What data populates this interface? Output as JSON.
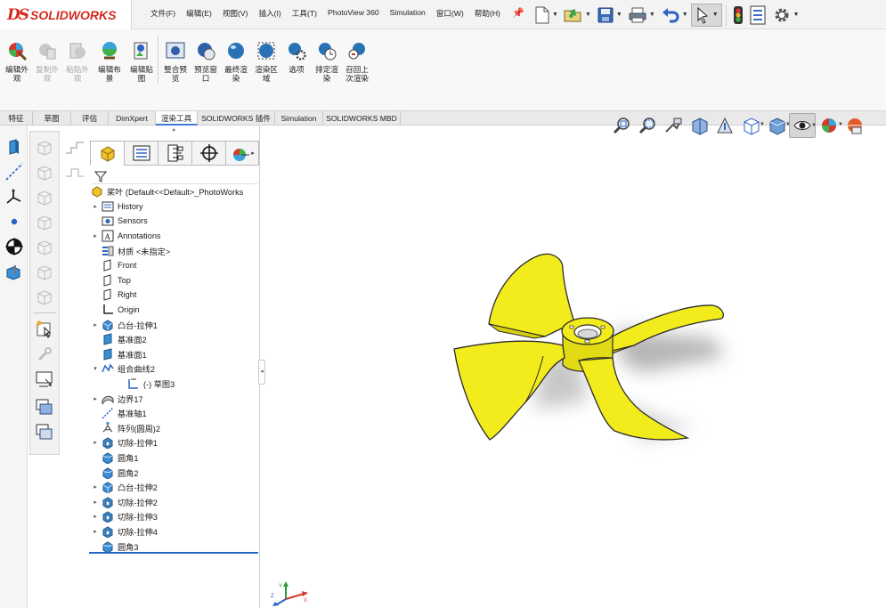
{
  "app": {
    "logo_prefix": "DS",
    "logo_text": "SOLIDWORKS",
    "brand_color": "#d32a1f"
  },
  "menu": [
    {
      "label": "文件(F)"
    },
    {
      "label": "编辑(E)"
    },
    {
      "label": "视图(V)"
    },
    {
      "label": "插入(I)"
    },
    {
      "label": "工具(T)"
    },
    {
      "label": "PhotoView 360"
    },
    {
      "label": "Simulation"
    },
    {
      "label": "窗口(W)"
    },
    {
      "label": "帮助(H)"
    }
  ],
  "quick_access": [
    {
      "icon": "new-document-icon"
    },
    {
      "icon": "open-folder-icon"
    },
    {
      "icon": "save-icon"
    },
    {
      "icon": "print-icon"
    },
    {
      "icon": "undo-icon"
    },
    {
      "icon": "select-cursor-icon"
    },
    {
      "icon": "rebuild-traffic-light-icon"
    },
    {
      "icon": "file-properties-icon"
    },
    {
      "icon": "options-gear-icon"
    }
  ],
  "commands": [
    {
      "label": "编辑外观",
      "icon": "edit-appearance-icon",
      "enabled": true
    },
    {
      "label": "复制外观",
      "icon": "copy-appearance-icon",
      "enabled": false
    },
    {
      "label": "粘贴外观",
      "icon": "paste-appearance-icon",
      "enabled": false
    },
    {
      "label": "编辑布景",
      "icon": "edit-scene-icon",
      "enabled": true
    },
    {
      "label": "编辑贴图",
      "icon": "edit-decal-icon",
      "enabled": true
    },
    {
      "label": "整合预览",
      "icon": "integrated-preview-icon",
      "enabled": true
    },
    {
      "label": "预览窗口",
      "icon": "preview-window-icon",
      "enabled": true
    },
    {
      "label": "最终渲染",
      "icon": "final-render-icon",
      "enabled": true
    },
    {
      "label": "渲染区域",
      "icon": "render-region-icon",
      "enabled": true
    },
    {
      "label": "选项",
      "icon": "render-options-icon",
      "enabled": true
    },
    {
      "label": "排定渲染",
      "icon": "schedule-render-icon",
      "enabled": true
    },
    {
      "label": "召回上次渲染",
      "icon": "recall-last-render-icon",
      "enabled": true
    }
  ],
  "tabs": [
    {
      "label": "特征",
      "active": false
    },
    {
      "label": "草图",
      "active": false
    },
    {
      "label": "评估",
      "active": false
    },
    {
      "label": "DimXpert",
      "active": false
    },
    {
      "label": "渲染工具",
      "active": true
    },
    {
      "label": "SOLIDWORKS 插件",
      "active": false
    },
    {
      "label": "Simulation",
      "active": false
    },
    {
      "label": "SOLIDWORKS MBD",
      "active": false
    }
  ],
  "heads_up_toolbar": [
    {
      "icon": "zoom-to-fit-icon"
    },
    {
      "icon": "zoom-to-area-icon"
    },
    {
      "icon": "previous-view-icon"
    },
    {
      "icon": "section-view-icon"
    },
    {
      "icon": "dynamic-annotation-views-icon"
    },
    {
      "icon": "view-orientation-icon"
    },
    {
      "icon": "display-style-icon"
    },
    {
      "icon": "hide-show-items-icon"
    },
    {
      "icon": "edit-appearance-icon"
    },
    {
      "icon": "apply-scene-icon"
    }
  ],
  "feature_manager": {
    "tabs": [
      {
        "icon": "feature-manager-tree-icon",
        "active": true
      },
      {
        "icon": "property-manager-icon",
        "active": false
      },
      {
        "icon": "configuration-manager-icon",
        "active": false
      },
      {
        "icon": "dimxpert-manager-icon",
        "active": false
      },
      {
        "icon": "display-manager-icon",
        "active": false
      }
    ],
    "filter_icon": "filter-funnel-icon",
    "root": {
      "label": "桨叶  (Default<<Default>_PhotoWorks",
      "icon": "part-icon"
    },
    "items": [
      {
        "label": "History",
        "icon": "history-folder-icon",
        "expander": "collapsed",
        "indent": 1
      },
      {
        "label": "Sensors",
        "icon": "sensors-icon",
        "expander": "none",
        "indent": 1
      },
      {
        "label": "Annotations",
        "icon": "annotations-icon",
        "expander": "collapsed",
        "indent": 1
      },
      {
        "label": "材质 <未指定>",
        "icon": "material-icon",
        "expander": "none",
        "indent": 1
      },
      {
        "label": "Front",
        "icon": "plane-icon",
        "expander": "none",
        "indent": 1
      },
      {
        "label": "Top",
        "icon": "plane-icon",
        "expander": "none",
        "indent": 1
      },
      {
        "label": "Right",
        "icon": "plane-icon",
        "expander": "none",
        "indent": 1
      },
      {
        "label": "Origin",
        "icon": "origin-icon",
        "expander": "none",
        "indent": 1
      },
      {
        "label": "凸台-拉伸1",
        "icon": "boss-extrude-icon",
        "expander": "collapsed",
        "indent": 1
      },
      {
        "label": "基准面2",
        "icon": "ref-plane-icon",
        "expander": "none",
        "indent": 1
      },
      {
        "label": "基准面1",
        "icon": "ref-plane-icon",
        "expander": "none",
        "indent": 1
      },
      {
        "label": "组合曲线2",
        "icon": "composite-curve-icon",
        "expander": "expanded",
        "indent": 1
      },
      {
        "label": "(-) 草图3",
        "icon": "sketch-icon",
        "expander": "none",
        "indent": 2
      },
      {
        "label": "边界17",
        "icon": "boundary-icon",
        "expander": "collapsed",
        "indent": 1
      },
      {
        "label": "基准轴1",
        "icon": "ref-axis-icon",
        "expander": "none",
        "indent": 1
      },
      {
        "label": "阵列(圆周)2",
        "icon": "circular-pattern-icon",
        "expander": "none",
        "indent": 1
      },
      {
        "label": "切除-拉伸1",
        "icon": "cut-extrude-icon",
        "expander": "collapsed",
        "indent": 1
      },
      {
        "label": "圆角1",
        "icon": "fillet-icon",
        "expander": "none",
        "indent": 1
      },
      {
        "label": "圆角2",
        "icon": "fillet-icon",
        "expander": "none",
        "indent": 1
      },
      {
        "label": "凸台-拉伸2",
        "icon": "boss-extrude-icon",
        "expander": "collapsed",
        "indent": 1
      },
      {
        "label": "切除-拉伸2",
        "icon": "cut-extrude-icon",
        "expander": "collapsed",
        "indent": 1
      },
      {
        "label": "切除-拉伸3",
        "icon": "cut-extrude-icon",
        "expander": "collapsed",
        "indent": 1
      },
      {
        "label": "切除-拉伸4",
        "icon": "cut-extrude-icon",
        "expander": "collapsed",
        "indent": 1
      },
      {
        "label": "圆角3",
        "icon": "fillet-icon",
        "expander": "none",
        "indent": 1
      }
    ]
  },
  "model": {
    "name": "propeller-model",
    "color": "#f3ec1d"
  }
}
